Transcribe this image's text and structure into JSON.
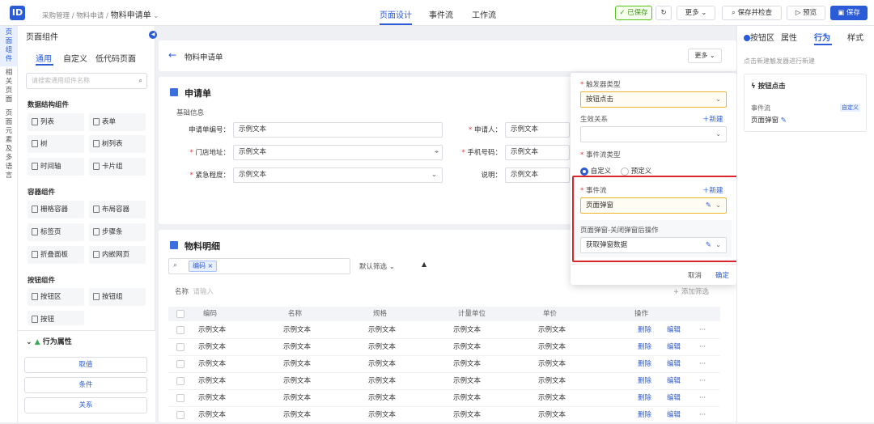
{
  "topbar": {
    "breadcrumb": [
      "采购管理",
      "物料申请"
    ],
    "doc_title": "物料申请单",
    "nav": [
      "页面设计",
      "事件流",
      "工作流"
    ],
    "saved": "已保存",
    "more": "更多",
    "save_check": "保存并检查",
    "preview": "预览",
    "save": "保存"
  },
  "strip": [
    "页面组件",
    "相关页面",
    "页面元素及多语言"
  ],
  "left": {
    "title": "页面组件",
    "tabs": [
      "通用",
      "自定义",
      "低代码页面"
    ],
    "search_placeholder": "请搜索通用组件名称",
    "sections": [
      {
        "title": "数据结构组件",
        "items": [
          "列表",
          "表单",
          "树",
          "树列表",
          "时间轴",
          "卡片组"
        ]
      },
      {
        "title": "容器组件",
        "items": [
          "栅格容器",
          "布局容器",
          "标签页",
          "步骤条",
          "折叠面板",
          "内嵌网页"
        ]
      },
      {
        "title": "按钮组件",
        "items": [
          "按钮区",
          "按钮组",
          "按钮"
        ]
      }
    ],
    "behavior": {
      "title": "行为属性",
      "buttons": [
        "取值",
        "条件",
        "关系"
      ]
    }
  },
  "page": {
    "title": "物料申请单",
    "more": "更多",
    "form": {
      "title": "申请单",
      "group": "基础信息",
      "fields": [
        {
          "label": "申请单编号：",
          "value": "示例文本",
          "req": false
        },
        {
          "label": "申请人：",
          "value": "示例文本",
          "req": true
        },
        {
          "label": "门店地址：",
          "value": "示例文本",
          "req": true
        },
        {
          "label": "手机号码：",
          "value": "示例文本",
          "req": true
        },
        {
          "label": "紧急程度：",
          "value": "示例文本",
          "req": true
        },
        {
          "label": "说明：",
          "value": "示例文本",
          "req": false
        }
      ]
    },
    "detail": {
      "title": "物料明细",
      "tag": "编码",
      "default_filter": "默认筛选",
      "name_label": "名称",
      "name_placeholder": "请输入",
      "add_filter": "+ 添加筛选",
      "columns": [
        "编码",
        "名称",
        "规格",
        "计量单位",
        "单价",
        "操作"
      ],
      "cell": "示例文本",
      "delete": "删除",
      "edit": "编辑",
      "rows": 6
    }
  },
  "popup": {
    "trigger_label": "触发器类型",
    "trigger_value": "按钮点击",
    "effect_label": "生效关系",
    "new": "新建",
    "flow_type_label": "事件流类型",
    "opt_custom": "自定义",
    "opt_preset": "预定义",
    "flow_label": "事件流",
    "flow_value": "页面弹窗",
    "after_label": "页面弹窗-关闭弹窗后操作",
    "after_value": "获取弹窗数据",
    "cancel": "取消",
    "ok": "确定"
  },
  "right": {
    "tabs": [
      "按钮区",
      "属性",
      "行为",
      "样式"
    ],
    "hint": "点击新建触发器进行新建",
    "trigger_title": "按钮点击",
    "flow_label": "事件流",
    "flow_tag": "自定义",
    "flow_value": "页面弹窗"
  }
}
